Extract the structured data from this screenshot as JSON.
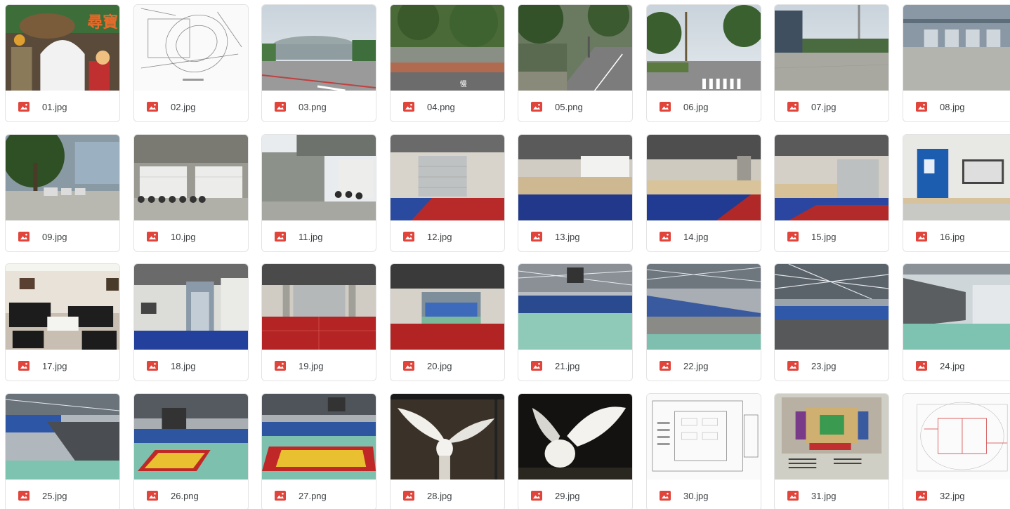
{
  "files": [
    {
      "name": "01.jpg",
      "icon": "image-file-icon",
      "thumb": "cartoon-sign"
    },
    {
      "name": "02.jpg",
      "icon": "image-file-icon",
      "thumb": "site-plan"
    },
    {
      "name": "03.png",
      "icon": "image-file-icon",
      "thumb": "street-arena"
    },
    {
      "name": "04.png",
      "icon": "image-file-icon",
      "thumb": "street-trees"
    },
    {
      "name": "05.png",
      "icon": "image-file-icon",
      "thumb": "street-road"
    },
    {
      "name": "06.jpg",
      "icon": "image-file-icon",
      "thumb": "street-crosswalk"
    },
    {
      "name": "07.jpg",
      "icon": "image-file-icon",
      "thumb": "plaza-building"
    },
    {
      "name": "08.jpg",
      "icon": "image-file-icon",
      "thumb": "plaza-doors"
    },
    {
      "name": "09.jpg",
      "icon": "image-file-icon",
      "thumb": "parking-tree"
    },
    {
      "name": "10.jpg",
      "icon": "image-file-icon",
      "thumb": "garage-scooters"
    },
    {
      "name": "11.jpg",
      "icon": "image-file-icon",
      "thumb": "wall-scooters"
    },
    {
      "name": "12.jpg",
      "icon": "image-file-icon",
      "thumb": "hall-red-floor"
    },
    {
      "name": "13.jpg",
      "icon": "image-file-icon",
      "thumb": "hall-blue-floor"
    },
    {
      "name": "14.jpg",
      "icon": "image-file-icon",
      "thumb": "hall-blue-red"
    },
    {
      "name": "15.jpg",
      "icon": "image-file-icon",
      "thumb": "hall-shutter"
    },
    {
      "name": "16.jpg",
      "icon": "image-file-icon",
      "thumb": "blue-door"
    },
    {
      "name": "17.jpg",
      "icon": "image-file-icon",
      "thumb": "lounge-sofas"
    },
    {
      "name": "18.jpg",
      "icon": "image-file-icon",
      "thumb": "corridor-elevator"
    },
    {
      "name": "19.jpg",
      "icon": "image-file-icon",
      "thumb": "hall-red-wide"
    },
    {
      "name": "20.jpg",
      "icon": "image-file-icon",
      "thumb": "hall-opening"
    },
    {
      "name": "21.jpg",
      "icon": "image-file-icon",
      "thumb": "arena-green"
    },
    {
      "name": "22.jpg",
      "icon": "image-file-icon",
      "thumb": "arena-stands"
    },
    {
      "name": "23.jpg",
      "icon": "image-file-icon",
      "thumb": "arena-roof"
    },
    {
      "name": "24.jpg",
      "icon": "image-file-icon",
      "thumb": "arena-corner"
    },
    {
      "name": "25.jpg",
      "icon": "image-file-icon",
      "thumb": "arena-seats"
    },
    {
      "name": "26.png",
      "icon": "image-file-icon",
      "thumb": "court-yellow"
    },
    {
      "name": "27.png",
      "icon": "image-file-icon",
      "thumb": "court-yellow-wide"
    },
    {
      "name": "28.jpg",
      "icon": "image-file-icon",
      "thumb": "sculpture-wings"
    },
    {
      "name": "29.jpg",
      "icon": "image-file-icon",
      "thumb": "sculpture-dark"
    },
    {
      "name": "30.jpg",
      "icon": "image-file-icon",
      "thumb": "floor-plan"
    },
    {
      "name": "31.jpg",
      "icon": "image-file-icon",
      "thumb": "color-map"
    },
    {
      "name": "32.jpg",
      "icon": "image-file-icon",
      "thumb": "red-plan"
    }
  ],
  "colors": {
    "icon_red": "#e0443a",
    "text": "#3c4043",
    "border": "#e3e3e3"
  }
}
